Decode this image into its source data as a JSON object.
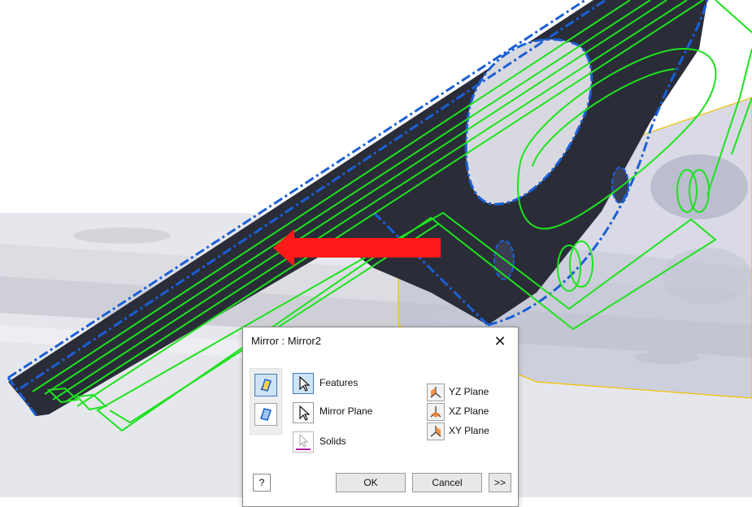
{
  "dialog": {
    "title": "Mirror : Mirror2",
    "close_glyph": "✕",
    "mirror_types": [
      {
        "name": "mirror-features-type-icon",
        "selected": true
      },
      {
        "name": "mirror-solids-type-icon",
        "selected": false
      }
    ],
    "selectors": {
      "features": "Features",
      "mirror_plane": "Mirror Plane",
      "solids": "Solids"
    },
    "planes": {
      "yz": "YZ Plane",
      "xz": "XZ Plane",
      "xy": "XY Plane"
    },
    "help_glyph": "?",
    "ok": "OK",
    "cancel": "Cancel",
    "more": ">>"
  },
  "colors": {
    "selection_green": "#1ee21e",
    "selection_blue": "#1a5fd6",
    "part_dark": "#2a2d38",
    "arrow_red": "#ff1a1a",
    "plane_yellow": "#f2c200",
    "active_button": "#cfe3f7"
  }
}
